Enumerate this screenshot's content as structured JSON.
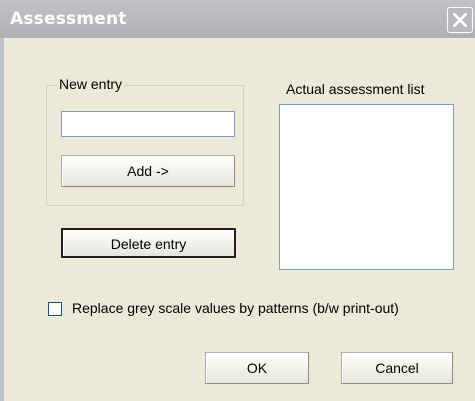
{
  "window": {
    "title": "Assessment",
    "close_icon": "close-icon"
  },
  "new_entry": {
    "group_label": "New entry",
    "input_value": "",
    "add_label": "Add ->"
  },
  "delete_label": "Delete entry",
  "assessment_list": {
    "label": "Actual assessment list",
    "items": []
  },
  "option": {
    "label": "Replace grey scale values by patterns (b/w print-out)",
    "checked": false
  },
  "buttons": {
    "ok_label": "OK",
    "cancel_label": "Cancel"
  }
}
